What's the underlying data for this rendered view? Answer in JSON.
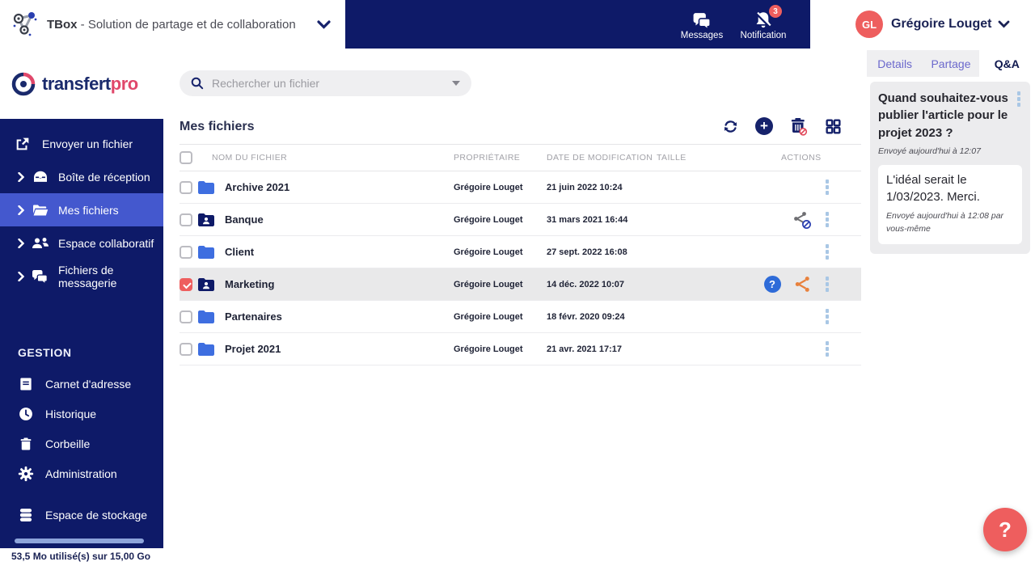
{
  "colors": {
    "navy": "#0e1a68",
    "accent": "#4458ce",
    "folder": "#3e6ee0",
    "salmon": "#ee5e5e",
    "tabpurple": "#6b68cc",
    "kebab": "#a9c7e5",
    "orange": "#e8813d",
    "qblue": "#2e6bd8"
  },
  "top_bar": {
    "app_name": "TBox",
    "app_subtitle": " - Solution de partage et de collaboration",
    "messages_label": "Messages",
    "notification_label": "Notification",
    "notification_count": "3",
    "user_initials": "GL",
    "user_name": "Grégoire Louget"
  },
  "sidebar": {
    "brand_part1": "transfert",
    "brand_part2": "pro",
    "items": [
      {
        "label": "Envoyer un fichier"
      },
      {
        "label": "Boîte de réception"
      },
      {
        "label": "Mes fichiers"
      },
      {
        "label": "Espace collaboratif"
      },
      {
        "label": "Fichiers de messagerie"
      }
    ],
    "section_title": "GESTION",
    "gestion_items": [
      {
        "label": "Carnet d'adresse"
      },
      {
        "label": "Historique"
      },
      {
        "label": "Corbeille"
      },
      {
        "label": "Administration"
      },
      {
        "label": "Espace de stockage"
      }
    ],
    "storage_text": "53,5 Mo utilisé(s) sur 15,00 Go"
  },
  "search": {
    "placeholder": "Rechercher un fichier"
  },
  "main": {
    "title": "Mes fichiers",
    "columns": [
      "NOM DU FICHIER",
      "PROPRIÉTAIRE",
      "DATE DE MODIFICATION",
      "TAILLE",
      "ACTIONS"
    ],
    "rows": [
      {
        "name": "Archive 2021",
        "owner": "Grégoire Louget",
        "date": "21 juin 2022 10:24",
        "size": ""
      },
      {
        "name": "Banque",
        "owner": "Grégoire Louget",
        "date": "31 mars 2021 16:44",
        "size": ""
      },
      {
        "name": "Client",
        "owner": "Grégoire Louget",
        "date": "27 sept. 2022 16:08",
        "size": ""
      },
      {
        "name": "Marketing",
        "owner": "Grégoire Louget",
        "date": "14 déc. 2022 10:07",
        "size": ""
      },
      {
        "name": "Partenaires",
        "owner": "Grégoire Louget",
        "date": "18 févr. 2020 09:24",
        "size": ""
      },
      {
        "name": "Projet 2021",
        "owner": "Grégoire Louget",
        "date": "21 avr. 2021 17:17",
        "size": ""
      }
    ]
  },
  "panel": {
    "tabs": [
      {
        "label": "Details"
      },
      {
        "label": "Partage"
      },
      {
        "label": "Q&A"
      }
    ],
    "question": {
      "text": "Quand souhaitez-vous publier l'article pour le projet 2023 ?",
      "meta": "Envoyé aujourd'hui à 12:07"
    },
    "reply": {
      "text": "L'idéal serait le 1/03/2023. Merci.",
      "meta": "Envoyé aujourd'hui à 12:08 par vous-même"
    }
  },
  "help_label": "?"
}
